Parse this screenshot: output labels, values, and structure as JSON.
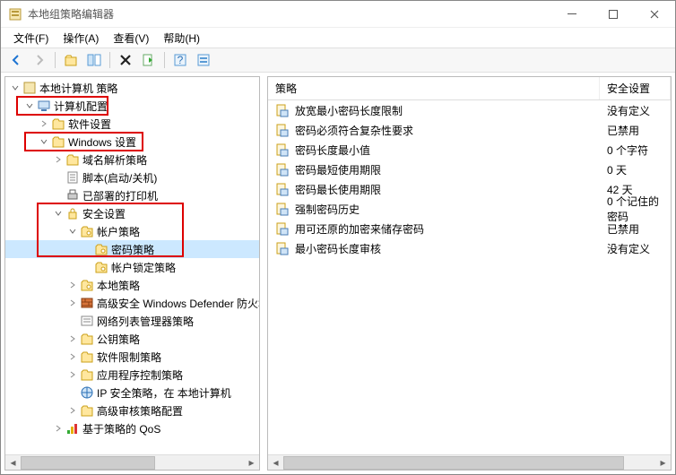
{
  "title": "本地组策略编辑器",
  "menu": {
    "file": "文件(F)",
    "action": "操作(A)",
    "view": "查看(V)",
    "help": "帮助(H)"
  },
  "toolbar_icons": [
    "back",
    "forward",
    "up",
    "show-hide",
    "delete",
    "export",
    "refresh",
    "help",
    "contents"
  ],
  "tree": {
    "root": "本地计算机 策略",
    "computer_config": "计算机配置",
    "software_settings": "软件设置",
    "windows_settings": "Windows 设置",
    "dns_policy": "域名解析策略",
    "scripts": "脚本(启动/关机)",
    "deployed_printers": "已部署的打印机",
    "security_settings": "安全设置",
    "account_policies": "帐户策略",
    "password_policy": "密码策略",
    "account_lockout": "帐户锁定策略",
    "local_policies": "本地策略",
    "wdf": "高级安全 Windows Defender 防火墙",
    "nlm": "网络列表管理器策略",
    "pubkey": "公钥策略",
    "srp": "软件限制策略",
    "appctl": "应用程序控制策略",
    "ipsec": "IP 安全策略，在 本地计算机",
    "audit": "高级审核策略配置",
    "qos": "基于策略的 QoS"
  },
  "list": {
    "col_policy": "策略",
    "col_setting": "安全设置",
    "rows": [
      {
        "name": "放宽最小密码长度限制",
        "value": "没有定义"
      },
      {
        "name": "密码必须符合复杂性要求",
        "value": "已禁用"
      },
      {
        "name": "密码长度最小值",
        "value": "0 个字符"
      },
      {
        "name": "密码最短使用期限",
        "value": "0 天"
      },
      {
        "name": "密码最长使用期限",
        "value": "42 天"
      },
      {
        "name": "强制密码历史",
        "value": "0 个记住的密码"
      },
      {
        "name": "用可还原的加密来储存密码",
        "value": "已禁用"
      },
      {
        "name": "最小密码长度审核",
        "value": "没有定义"
      }
    ]
  }
}
